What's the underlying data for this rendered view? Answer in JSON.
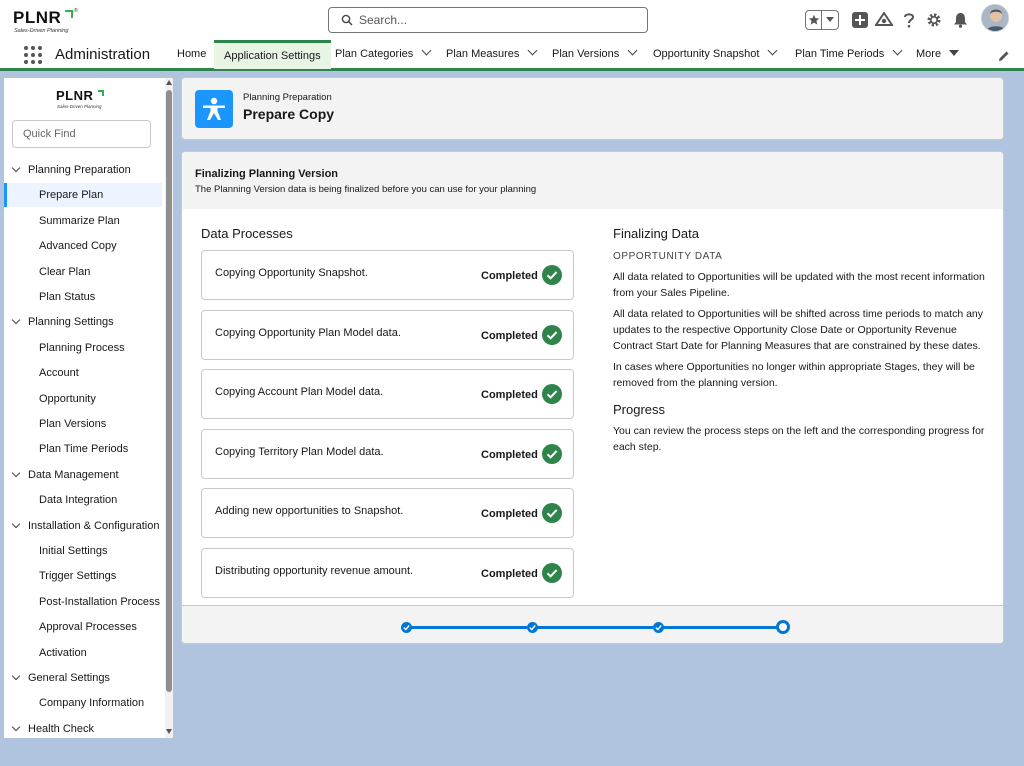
{
  "header": {
    "logo_text": "PLNR",
    "logo_tagline": "Sales-Driven Planning",
    "logo_reg": "®",
    "search_placeholder": "Search..."
  },
  "navbar": {
    "app_name": "Administration",
    "items": [
      {
        "label": "Home",
        "dropdown": false
      },
      {
        "label": "Application Settings",
        "dropdown": false,
        "active": true
      },
      {
        "label": "Plan Categories",
        "dropdown": true
      },
      {
        "label": "Plan Measures",
        "dropdown": true
      },
      {
        "label": "Plan Versions",
        "dropdown": true
      },
      {
        "label": "Opportunity Snapshot",
        "dropdown": true
      },
      {
        "label": "Plan Time Periods",
        "dropdown": true
      },
      {
        "label": "More",
        "dropdown": true
      }
    ]
  },
  "sidebar": {
    "logo_text": "PLNR",
    "logo_tagline": "Sales-Driven Planning",
    "quickfind_placeholder": "Quick Find",
    "rows": [
      {
        "label": "Planning Preparation",
        "type": "section"
      },
      {
        "label": "Prepare Plan",
        "type": "child",
        "selected": true
      },
      {
        "label": "Summarize Plan",
        "type": "child"
      },
      {
        "label": "Advanced Copy",
        "type": "child"
      },
      {
        "label": "Clear Plan",
        "type": "child"
      },
      {
        "label": "Plan Status",
        "type": "child"
      },
      {
        "label": "Planning Settings",
        "type": "section"
      },
      {
        "label": "Planning Process",
        "type": "child"
      },
      {
        "label": "Account",
        "type": "child"
      },
      {
        "label": "Opportunity",
        "type": "child"
      },
      {
        "label": "Plan Versions",
        "type": "child"
      },
      {
        "label": "Plan Time Periods",
        "type": "child"
      },
      {
        "label": "Data Management",
        "type": "section"
      },
      {
        "label": "Data Integration",
        "type": "child"
      },
      {
        "label": "Installation & Configuration",
        "type": "section"
      },
      {
        "label": "Initial Settings",
        "type": "child"
      },
      {
        "label": "Trigger Settings",
        "type": "child"
      },
      {
        "label": "Post-Installation Process",
        "type": "child"
      },
      {
        "label": "Approval Processes",
        "type": "child"
      },
      {
        "label": "Activation",
        "type": "child"
      },
      {
        "label": "General Settings",
        "type": "section"
      },
      {
        "label": "Company Information",
        "type": "child"
      },
      {
        "label": "Health Check",
        "type": "section"
      }
    ]
  },
  "page_header": {
    "subtitle": "Planning Preparation",
    "title": "Prepare Copy"
  },
  "main": {
    "title": "Finalizing Planning Version",
    "description": "The Planning Version data is being finalized before you can use for your planning",
    "data_processes_title": "Data Processes",
    "processes": [
      {
        "label": "Copying Opportunity Snapshot.",
        "status": "Completed"
      },
      {
        "label": "Copying Opportunity Plan Model data.",
        "status": "Completed"
      },
      {
        "label": "Copying Account Plan Model data.",
        "status": "Completed"
      },
      {
        "label": "Copying Territory Plan Model data.",
        "status": "Completed"
      },
      {
        "label": "Adding new opportunities to Snapshot.",
        "status": "Completed"
      },
      {
        "label": "Distributing opportunity revenue amount.",
        "status": "Completed"
      }
    ],
    "finalizing_title": "Finalizing Data",
    "opportunity_label": "OPPORTUNITY DATA",
    "paragraphs": [
      "All data related to Opportunities will be updated with the most recent information from your Sales Pipeline.",
      "All data related to Opportunities will be shifted across time periods to match any updates to the respective Opportunity Close Date or Opportunity Revenue Contract Start Date for Planning Measures that are constrained by these dates.",
      "In cases where Opportunities no longer within appropriate Stages, they will be removed from the planning version."
    ],
    "progress_title": "Progress",
    "progress_text": "You can review the process steps on the left and the corresponding progress for each step.",
    "steps": [
      {
        "state": "complete"
      },
      {
        "state": "complete"
      },
      {
        "state": "complete"
      },
      {
        "state": "current"
      }
    ]
  },
  "colors": {
    "accent_green": "#2e844a",
    "brand_blue": "#1b96ff",
    "progress_blue": "#0176d3",
    "check_green": "#2e844a",
    "background": "#b0c4df"
  }
}
